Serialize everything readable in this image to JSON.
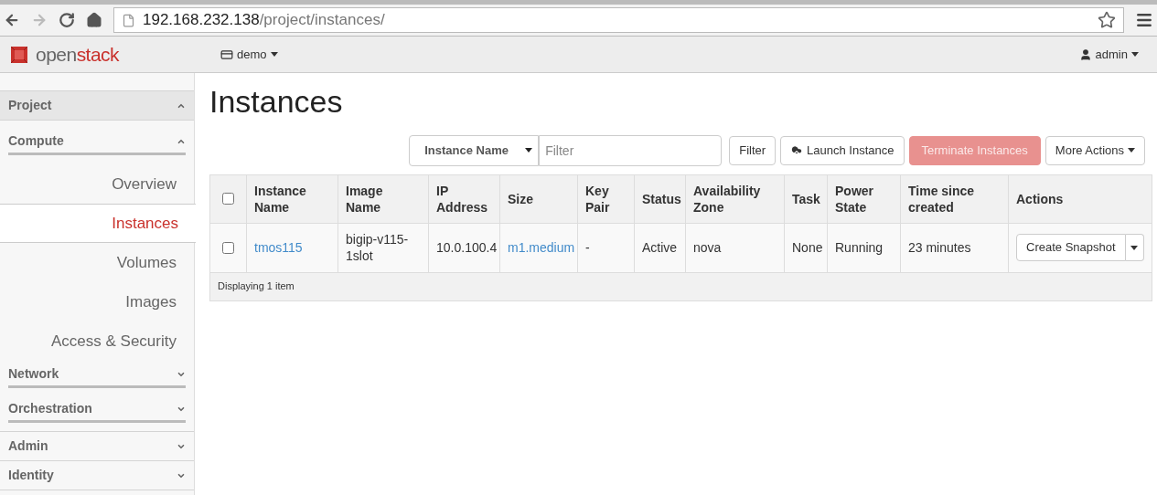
{
  "browser": {
    "url_host": "192.168.232.138",
    "url_path": "/project/instances/"
  },
  "topnav": {
    "logo_parts": [
      "open",
      "stack"
    ],
    "project": "demo",
    "user": "admin"
  },
  "sidebar": [
    {
      "label": "Project",
      "expanded": true,
      "panels": [
        {
          "label": "Compute",
          "expanded": true,
          "items": [
            {
              "label": "Overview",
              "selected": false
            },
            {
              "label": "Instances",
              "selected": true
            },
            {
              "label": "Volumes",
              "selected": false
            },
            {
              "label": "Images",
              "selected": false
            },
            {
              "label": "Access & Security",
              "selected": false
            }
          ]
        },
        {
          "label": "Network",
          "expanded": false
        },
        {
          "label": "Orchestration",
          "expanded": false
        }
      ]
    },
    {
      "label": "Admin",
      "expanded": false
    },
    {
      "label": "Identity",
      "expanded": false
    }
  ],
  "page_title": "Instances",
  "toolbar": {
    "filter_select": "Instance Name",
    "filter_placeholder": "Filter",
    "buttons": [
      {
        "label": "Filter",
        "kind": "plain",
        "disabled": false
      },
      {
        "label": "Launch Instance",
        "kind": "launch",
        "disabled": false
      },
      {
        "label": "Terminate Instances",
        "kind": "danger",
        "disabled": true
      },
      {
        "label": "More Actions",
        "kind": "dropdown",
        "disabled": false
      }
    ]
  },
  "table": {
    "select_all_checked": false,
    "columns": [
      "Instance Name",
      "Image Name",
      "IP Address",
      "Size",
      "Key Pair",
      "Status",
      "Availability Zone",
      "Task",
      "Power State",
      "Time since created",
      "Actions"
    ],
    "rows": [
      {
        "checked": false,
        "cells": [
          {
            "text": "tmos115",
            "kind": "link"
          },
          {
            "text": "bigip-v115-1slot",
            "kind": "text"
          },
          {
            "text": "10.0.100.4",
            "kind": "text"
          },
          {
            "text": "m1.medium",
            "kind": "link"
          },
          {
            "text": "-",
            "kind": "text"
          },
          {
            "text": "Active",
            "kind": "text"
          },
          {
            "text": "nova",
            "kind": "text"
          },
          {
            "text": "None",
            "kind": "text"
          },
          {
            "text": "Running",
            "kind": "text"
          },
          {
            "text": "23 minutes",
            "kind": "text"
          }
        ],
        "action": "Create Snapshot"
      }
    ],
    "footer": "Displaying 1 item"
  }
}
